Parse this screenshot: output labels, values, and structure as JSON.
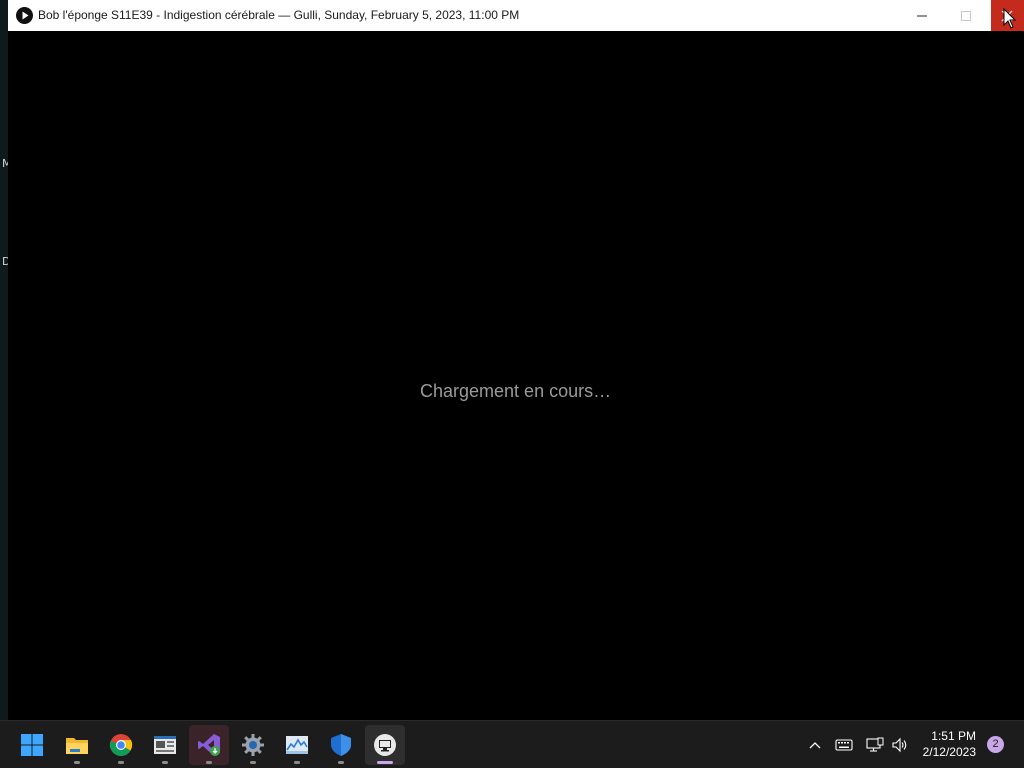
{
  "window": {
    "title": "Bob l'éponge S11E39 - Indigestion cérébrale — Gulli, Sunday, February 5, 2023, 11:00 PM",
    "app_icon": "play-icon",
    "controls": {
      "minimize": "minimize-icon",
      "maximize": "maximize-icon",
      "close": "close-icon"
    },
    "close_color": "#c42b1c"
  },
  "content": {
    "status_text": "Chargement en cours…",
    "background": "#000000"
  },
  "desktop_edge": {
    "chars": [
      "M",
      "D"
    ]
  },
  "taskbar": {
    "start_icon": "windows-start-icon",
    "apps": [
      {
        "name": "file-explorer",
        "icon": "folder-icon",
        "running": true
      },
      {
        "name": "chrome",
        "icon": "chrome-icon",
        "running": true
      },
      {
        "name": "news-app",
        "icon": "news-icon",
        "running": true
      },
      {
        "name": "visual-studio-installer",
        "icon": "visual-studio-icon",
        "running": true
      },
      {
        "name": "settings",
        "icon": "gear-icon",
        "running": true
      },
      {
        "name": "performance-monitor",
        "icon": "chart-icon",
        "running": true
      },
      {
        "name": "windows-security",
        "icon": "shield-icon",
        "running": true
      },
      {
        "name": "remote-desktop",
        "icon": "monitor-icon",
        "running": true,
        "active": true
      }
    ],
    "tray": {
      "overflow_icon": "chevron-up-icon",
      "keyboard_icon": "keyboard-icon",
      "network_icon": "network-icon",
      "volume_icon": "speaker-icon",
      "time": "1:51 PM",
      "date": "2/12/2023",
      "notifications": "2"
    },
    "accent": "#c9a7e8"
  }
}
